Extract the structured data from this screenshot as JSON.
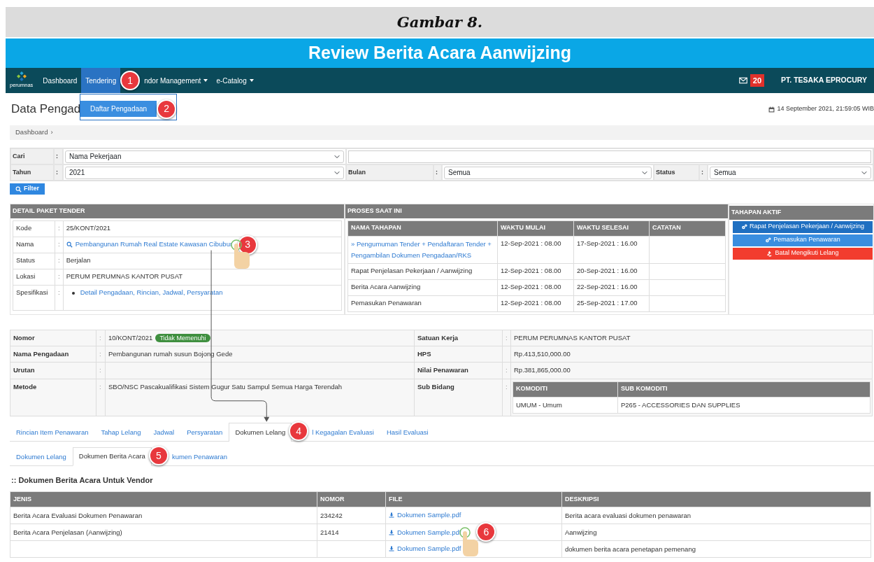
{
  "figure": {
    "caption": "Gambar 8.",
    "title": "Review Berita Acara Aanwijzing"
  },
  "navbar": {
    "logo_text": "perumnas",
    "items": [
      {
        "label": "Dashboard",
        "selected": false,
        "dropdown": false
      },
      {
        "label": "Tendering",
        "selected": true,
        "dropdown": false,
        "marker": "1"
      },
      {
        "label": "ndor Management",
        "selected": false,
        "dropdown": true
      },
      {
        "label": "e-Catalog",
        "selected": false,
        "dropdown": true
      }
    ],
    "menu": [
      {
        "label": "Daftar Pengadaan",
        "selected": true,
        "marker": "2"
      }
    ],
    "mail_count": "20",
    "company": "PT. TESAKA EPROCURY"
  },
  "page": {
    "title": "Data Pengad",
    "datetime": "14 September 2021, 21:59:05 WIB"
  },
  "breadcrumb": {
    "items": [
      "Dashboard"
    ],
    "separator": "›"
  },
  "filter": {
    "sep": ":",
    "rows": [
      [
        {
          "label": "Cari",
          "kind": "select",
          "value": "Nama Pekerjaan"
        },
        {
          "kind": "text"
        }
      ],
      [
        {
          "label": "Tahun",
          "kind": "select",
          "value": "2021"
        },
        {
          "label": "Bulan",
          "kind": "select",
          "value": "Semua"
        },
        {
          "label": "Status",
          "kind": "select",
          "value": "Semua"
        }
      ]
    ],
    "button": "Filter"
  },
  "detail": {
    "title": "DETAIL PAKET TENDER",
    "sep": ":",
    "rows": [
      {
        "label": "Kode",
        "kind": "text",
        "value": "25/KONT/2021"
      },
      {
        "label": "Nama",
        "kind": "link",
        "value": "Pembangunan Rumah Real Estate Kawasan Cibubur",
        "marker": "3",
        "cursor": true
      },
      {
        "label": "Status",
        "kind": "text",
        "value": "Berjalan"
      },
      {
        "label": "Lokasi",
        "kind": "text",
        "value": "PERUM PERUMNAS KANTOR PUSAT"
      },
      {
        "label": "Spesifikasi",
        "kind": "list",
        "items": [
          "Detail Pengadaan, Rincian, Jadwal, Persyaratan"
        ]
      }
    ]
  },
  "proses": {
    "title": "PROSES SAAT INI",
    "columns": [
      "NAMA TAHAPAN",
      "WAKTU MULAI",
      "WAKTU SELESAI",
      "CATATAN"
    ],
    "rows": [
      {
        "current": true,
        "name": "» Pengumuman Tender + Pendaftaran Tender + Pengambilan Dokumen Pengadaan/RKS",
        "start": "12-Sep-2021 : 08.00",
        "end": "17-Sep-2021 : 16.00"
      },
      {
        "current": false,
        "name": "Rapat Penjelasan Pekerjaan / Aanwijzing",
        "start": "12-Sep-2021 : 08.00",
        "end": "20-Sep-2021 : 16.00"
      },
      {
        "current": false,
        "name": "Berita Acara Aanwijzing",
        "start": "12-Sep-2021 : 08.00",
        "end": "22-Sep-2021 : 16.00"
      },
      {
        "current": false,
        "name": "Pemasukan Penawaran",
        "start": "12-Sep-2021 : 08.00",
        "end": "25-Sep-2021 : 17.00"
      }
    ]
  },
  "tahapan": {
    "title": "TAHAPAN AKTIF",
    "buttons": [
      {
        "label": "Rapat Penjelasan Pekerjaan / Aanwijzing",
        "kind": "primary"
      },
      {
        "label": "Pemasukan Penawaran",
        "kind": "info"
      },
      {
        "label": "Batal Mengikuti Lelang",
        "kind": "danger"
      }
    ]
  },
  "info": {
    "left": [
      {
        "label": "Nomor",
        "sep": ":",
        "value": "10/KONT/2021",
        "badge": "Tidak Memenuhi"
      },
      {
        "label": "Nama Pengadaan",
        "sep": ":",
        "value": "Pembangunan rumah susun Bojong Gede"
      },
      {
        "label": "Urutan",
        "sep": ":"
      },
      {
        "label": "Metode",
        "sep": ":",
        "value": "SBO/NSC Pascakualifikasi Sistem Gugur Satu Sampul Semua Harga Terendah"
      }
    ],
    "right": [
      {
        "label": "Satuan Kerja",
        "sep": ":",
        "value": "PERUM PERUMNAS KANTOR PUSAT"
      },
      {
        "label": "HPS",
        "value": "Rp.413,510,000.00"
      },
      {
        "label": "Nilai Penawaran",
        "sep": ":",
        "value": "Rp.381,865,000.00"
      },
      {
        "label": "Sub Bidang",
        "sep": ":",
        "table": {
          "columns": [
            "KOMODITI",
            "SUB KOMODITI"
          ],
          "rows": [
            [
              "UMUM - Umum",
              "P265 - ACCESSORIES DAN SUPPLIES"
            ]
          ]
        }
      }
    ]
  },
  "tabs": [
    {
      "label": "Rincian Item Penawaran",
      "selected": false
    },
    {
      "label": "Tahap Lelang",
      "selected": false
    },
    {
      "label": "Jadwal",
      "selected": false
    },
    {
      "label": "Persyaratan",
      "selected": false
    },
    {
      "label": "Dokumen Lelang",
      "selected": true,
      "marker": "4"
    },
    {
      "label": "l Kegagalan Evaluasi",
      "selected": false
    },
    {
      "label": "Hasil Evaluasi",
      "selected": false
    }
  ],
  "subtabs": [
    {
      "label": "Dokumen Lelang",
      "selected": false
    },
    {
      "label": "Dokumen Berita Acara",
      "selected": true,
      "marker": "5"
    },
    {
      "label": "kumen Penawaran",
      "selected": false
    }
  ],
  "section_title": ":: Dokumen Berita Acara Untuk Vendor",
  "documents": {
    "columns": [
      "JENIS",
      "NOMOR",
      "FILE",
      "DESKRIPSI"
    ],
    "rows": [
      {
        "jenis": "Berita Acara Evaluasi Dokumen Penawaran",
        "nomor": "234242",
        "file": "Dokumen Sample.pdf",
        "deskripsi": "Berita acara evaluasi dokumen penawaran"
      },
      {
        "jenis": "Berita Acara Penjelasan (Aanwijzing)",
        "nomor": "21414",
        "file": "Dokumen Sample.pdf",
        "deskripsi": "Aanwijzing",
        "marker": "6",
        "cursor": true
      },
      {
        "file": "Dokumen Sample.pdf",
        "deskripsi": "dokumen berita acara penetapan pemenang"
      }
    ]
  }
}
